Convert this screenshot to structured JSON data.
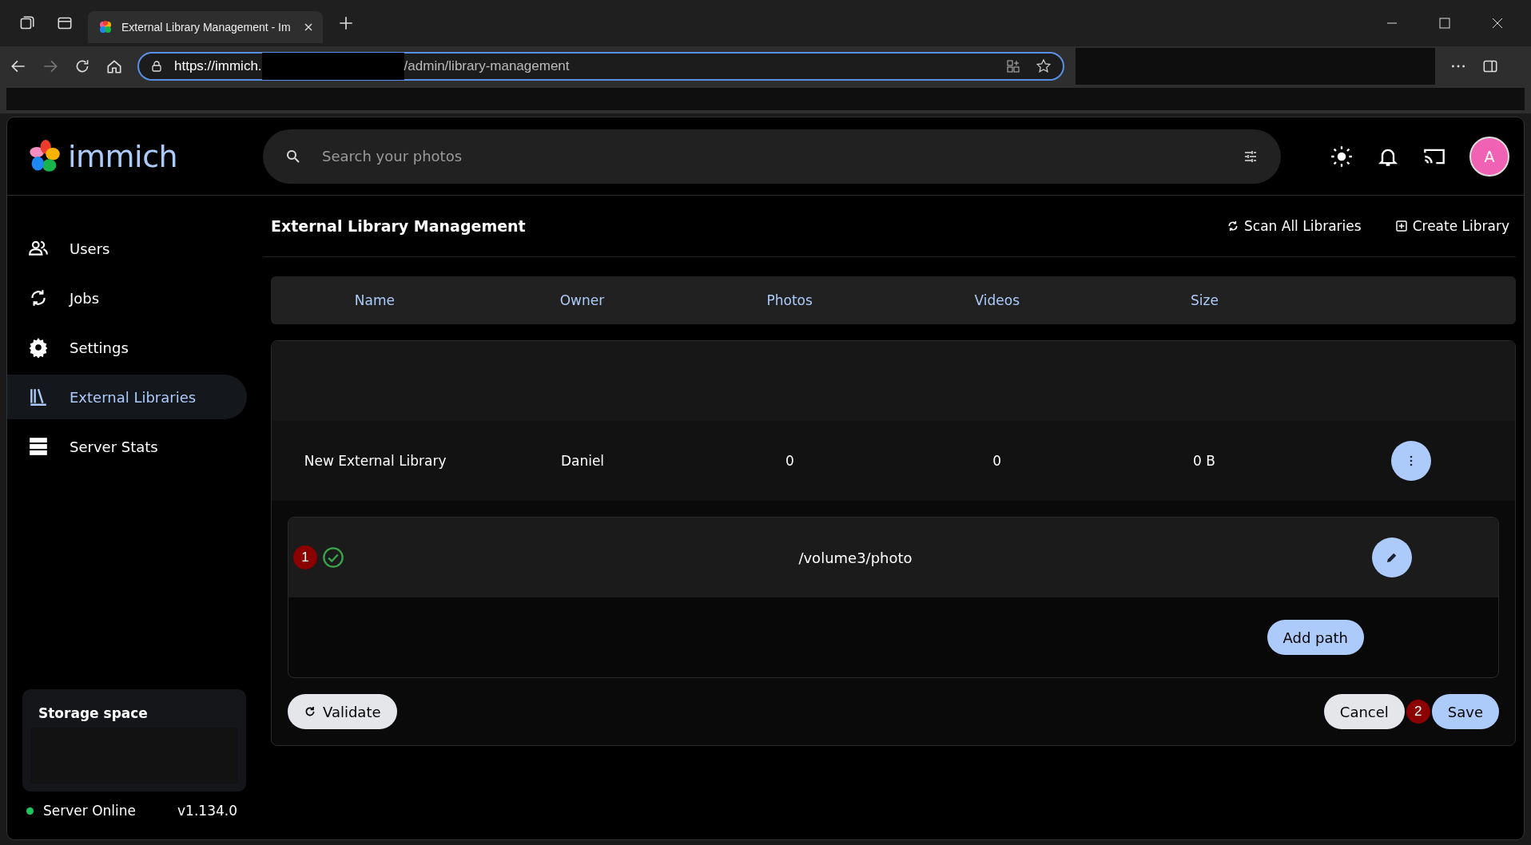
{
  "browser": {
    "tab_title": "External Library Management - Im",
    "url_host": "https://immich.",
    "url_path": "/admin/library-management"
  },
  "header": {
    "logo_text": "immich",
    "search_placeholder": "Search your photos",
    "avatar_initial": "A"
  },
  "sidebar": {
    "items": [
      {
        "label": "Users",
        "selected": false
      },
      {
        "label": "Jobs",
        "selected": false
      },
      {
        "label": "Settings",
        "selected": false
      },
      {
        "label": "External Libraries",
        "selected": true
      },
      {
        "label": "Server Stats",
        "selected": false
      }
    ],
    "storage_title": "Storage space",
    "server_status": "Server Online",
    "online": true,
    "version": "v1.134.0"
  },
  "page": {
    "title": "External Library Management",
    "actions": [
      {
        "label": "Scan All Libraries",
        "kind": "scan"
      },
      {
        "label": "Create Library",
        "kind": "create"
      }
    ]
  },
  "table": {
    "columns": [
      "Name",
      "Owner",
      "Photos",
      "Videos",
      "Size"
    ],
    "rows": [
      {
        "cells": [
          "New External Library",
          "Daniel",
          "0",
          "0",
          "0 B"
        ]
      }
    ]
  },
  "editor": {
    "paths": [
      {
        "path": "/volume3/photo",
        "valid": true,
        "annotation": "1"
      }
    ],
    "add_path": "Add path",
    "validate": "Validate",
    "cancel": "Cancel",
    "save": "Save",
    "save_annotation": "2"
  }
}
